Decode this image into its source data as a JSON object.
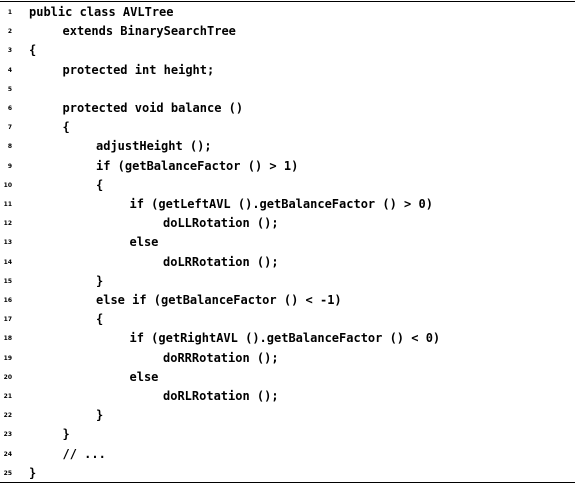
{
  "listing": {
    "lines": [
      {
        "num": "1",
        "text": "public class AVLTree"
      },
      {
        "num": "2",
        "text": "extends BinarySearchTree"
      },
      {
        "num": "3",
        "text": "{"
      },
      {
        "num": "4",
        "text": "protected int height;"
      },
      {
        "num": "5",
        "text": ""
      },
      {
        "num": "6",
        "text": "protected void balance ()"
      },
      {
        "num": "7",
        "text": "{"
      },
      {
        "num": "8",
        "text": "adjustHeight ();"
      },
      {
        "num": "9",
        "text": "if (getBalanceFactor () > 1)"
      },
      {
        "num": "10",
        "text": "{"
      },
      {
        "num": "11",
        "text": "if (getLeftAVL ().getBalanceFactor () > 0)"
      },
      {
        "num": "12",
        "text": "doLLRotation ();"
      },
      {
        "num": "13",
        "text": "else"
      },
      {
        "num": "14",
        "text": "doLRRotation ();"
      },
      {
        "num": "15",
        "text": "}"
      },
      {
        "num": "16",
        "text": "else if (getBalanceFactor () < -1)"
      },
      {
        "num": "17",
        "text": "{"
      },
      {
        "num": "18",
        "text": "if (getRightAVL ().getBalanceFactor () < 0)"
      },
      {
        "num": "19",
        "text": "doRRRotation ();"
      },
      {
        "num": "20",
        "text": "else"
      },
      {
        "num": "21",
        "text": "doRLRotation ();"
      },
      {
        "num": "22",
        "text": "}"
      },
      {
        "num": "23",
        "text": "}"
      },
      {
        "num": "24",
        "text": "// ..."
      },
      {
        "num": "25",
        "text": "}"
      }
    ]
  }
}
